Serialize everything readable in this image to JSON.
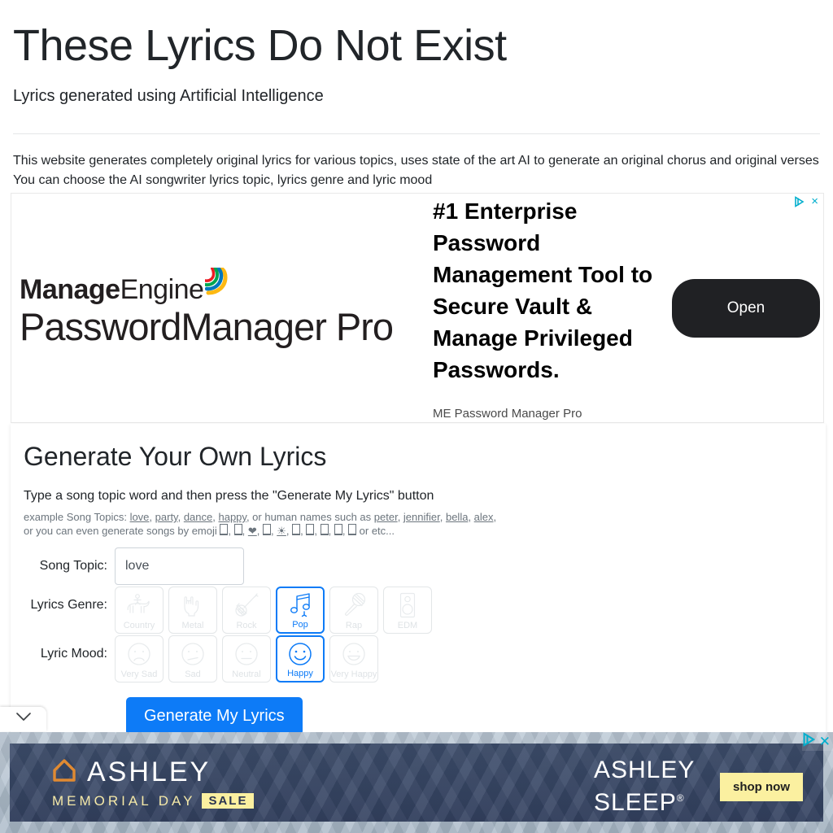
{
  "header": {
    "title": "These Lyrics Do Not Exist",
    "subtitle": "Lyrics generated using Artificial Intelligence",
    "intro_line1": "This website generates completely original lyrics for various topics, uses state of the art AI to generate an original chorus and original verses",
    "intro_line2": "You can choose the AI songwriter lyrics topic, lyrics genre and lyric mood"
  },
  "ad_top": {
    "logo_line1_bold": "Manage",
    "logo_line1_light": "Engine",
    "logo_line2": "PasswordManager Pro",
    "headline": "#1 Enterprise Password Management Tool to Secure Vault & Manage Privileged Passwords.",
    "advertiser": "ME Password Manager Pro",
    "cta_label": "Open",
    "close_label": "×"
  },
  "generator": {
    "title": "Generate Your Own Lyrics",
    "instruction": "Type a song topic word and then press the \"Generate My Lyrics\" button",
    "examples_prefix": "example Song Topics: ",
    "example_topics": [
      "love",
      "party",
      "dance",
      "happy"
    ],
    "examples_mid": ", or human names such as ",
    "example_names": [
      "peter",
      "jennifier",
      "bella",
      "alex"
    ],
    "emoji_line_prefix": "or you can even generate songs by emoji ",
    "emoji_line_suffix": " or etc...",
    "emoji_items": [
      "□",
      "□",
      "❤",
      "□",
      "☀",
      "□",
      "□",
      "□",
      "□",
      "□"
    ],
    "topic_label": "Song Topic:",
    "topic_value": "love",
    "topic_placeholder": "",
    "genre_label": "Lyrics Genre:",
    "genres": [
      {
        "label": "Country",
        "icon": "horse-rider-icon",
        "selected": false
      },
      {
        "label": "Metal",
        "icon": "rock-hand-icon",
        "selected": false
      },
      {
        "label": "Rock",
        "icon": "electric-guitar-icon",
        "selected": false
      },
      {
        "label": "Pop",
        "icon": "music-notes-icon",
        "selected": true
      },
      {
        "label": "Rap",
        "icon": "microphone-icon",
        "selected": false
      },
      {
        "label": "EDM",
        "icon": "speaker-icon",
        "selected": false
      }
    ],
    "mood_label": "Lyric Mood:",
    "moods": [
      {
        "label": "Very Sad",
        "icon": "very-sad-face-icon",
        "selected": false
      },
      {
        "label": "Sad",
        "icon": "sad-face-icon",
        "selected": false
      },
      {
        "label": "Neutral",
        "icon": "neutral-face-icon",
        "selected": false
      },
      {
        "label": "Happy",
        "icon": "happy-face-icon",
        "selected": true
      },
      {
        "label": "Very Happy",
        "icon": "very-happy-face-icon",
        "selected": false
      }
    ],
    "submit_label": "Generate My Lyrics",
    "accent_color": "#0d7bf7"
  },
  "ad_bottom": {
    "brand": "ASHLEY",
    "promo_text": "MEMORIAL DAY",
    "promo_badge": "SALE",
    "product_line1": "ASHLEY",
    "product_line2": "SLEEP",
    "cta_label": "shop now",
    "close_label": "✕"
  },
  "collapse_tab": {
    "icon": "chevron-down-icon"
  }
}
